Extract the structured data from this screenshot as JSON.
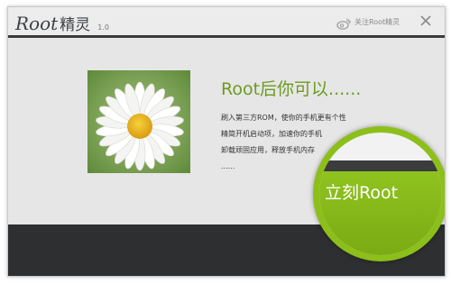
{
  "app": {
    "logo_root": "Root",
    "logo_cn": "精灵",
    "version": "1.0"
  },
  "titlebar": {
    "follow_label": "关注Root精灵",
    "follow_icon": "weibo-icon",
    "close_icon": "close-icon"
  },
  "main": {
    "headline": "Root后你可以......",
    "lines": [
      "刷入第三方ROM，使你的手机更有个性",
      "精简开机启动项，加速你的手机",
      "卸载顽固应用，释放手机内存",
      "......"
    ],
    "image": "daisy-flower-photo"
  },
  "cta": {
    "label": "立刻Root"
  },
  "colors": {
    "accent_green": "#8cbf1a",
    "headline_green": "#6c9a1e",
    "footer_dark": "#2d2f31",
    "title_line": "#3a3a3a"
  }
}
